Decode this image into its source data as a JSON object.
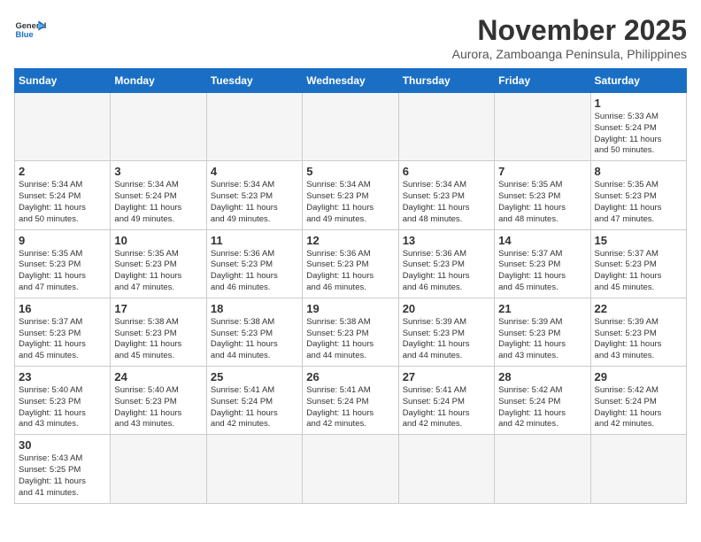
{
  "header": {
    "logo_general": "General",
    "logo_blue": "Blue",
    "month_title": "November 2025",
    "subtitle": "Aurora, Zamboanga Peninsula, Philippines"
  },
  "days_of_week": [
    "Sunday",
    "Monday",
    "Tuesday",
    "Wednesday",
    "Thursday",
    "Friday",
    "Saturday"
  ],
  "weeks": [
    [
      {
        "day": "",
        "info": ""
      },
      {
        "day": "",
        "info": ""
      },
      {
        "day": "",
        "info": ""
      },
      {
        "day": "",
        "info": ""
      },
      {
        "day": "",
        "info": ""
      },
      {
        "day": "",
        "info": ""
      },
      {
        "day": "1",
        "info": "Sunrise: 5:33 AM\nSunset: 5:24 PM\nDaylight: 11 hours\nand 50 minutes."
      }
    ],
    [
      {
        "day": "2",
        "info": "Sunrise: 5:34 AM\nSunset: 5:24 PM\nDaylight: 11 hours\nand 50 minutes."
      },
      {
        "day": "3",
        "info": "Sunrise: 5:34 AM\nSunset: 5:24 PM\nDaylight: 11 hours\nand 49 minutes."
      },
      {
        "day": "4",
        "info": "Sunrise: 5:34 AM\nSunset: 5:23 PM\nDaylight: 11 hours\nand 49 minutes."
      },
      {
        "day": "5",
        "info": "Sunrise: 5:34 AM\nSunset: 5:23 PM\nDaylight: 11 hours\nand 49 minutes."
      },
      {
        "day": "6",
        "info": "Sunrise: 5:34 AM\nSunset: 5:23 PM\nDaylight: 11 hours\nand 48 minutes."
      },
      {
        "day": "7",
        "info": "Sunrise: 5:35 AM\nSunset: 5:23 PM\nDaylight: 11 hours\nand 48 minutes."
      },
      {
        "day": "8",
        "info": "Sunrise: 5:35 AM\nSunset: 5:23 PM\nDaylight: 11 hours\nand 47 minutes."
      }
    ],
    [
      {
        "day": "9",
        "info": "Sunrise: 5:35 AM\nSunset: 5:23 PM\nDaylight: 11 hours\nand 47 minutes."
      },
      {
        "day": "10",
        "info": "Sunrise: 5:35 AM\nSunset: 5:23 PM\nDaylight: 11 hours\nand 47 minutes."
      },
      {
        "day": "11",
        "info": "Sunrise: 5:36 AM\nSunset: 5:23 PM\nDaylight: 11 hours\nand 46 minutes."
      },
      {
        "day": "12",
        "info": "Sunrise: 5:36 AM\nSunset: 5:23 PM\nDaylight: 11 hours\nand 46 minutes."
      },
      {
        "day": "13",
        "info": "Sunrise: 5:36 AM\nSunset: 5:23 PM\nDaylight: 11 hours\nand 46 minutes."
      },
      {
        "day": "14",
        "info": "Sunrise: 5:37 AM\nSunset: 5:23 PM\nDaylight: 11 hours\nand 45 minutes."
      },
      {
        "day": "15",
        "info": "Sunrise: 5:37 AM\nSunset: 5:23 PM\nDaylight: 11 hours\nand 45 minutes."
      }
    ],
    [
      {
        "day": "16",
        "info": "Sunrise: 5:37 AM\nSunset: 5:23 PM\nDaylight: 11 hours\nand 45 minutes."
      },
      {
        "day": "17",
        "info": "Sunrise: 5:38 AM\nSunset: 5:23 PM\nDaylight: 11 hours\nand 45 minutes."
      },
      {
        "day": "18",
        "info": "Sunrise: 5:38 AM\nSunset: 5:23 PM\nDaylight: 11 hours\nand 44 minutes."
      },
      {
        "day": "19",
        "info": "Sunrise: 5:38 AM\nSunset: 5:23 PM\nDaylight: 11 hours\nand 44 minutes."
      },
      {
        "day": "20",
        "info": "Sunrise: 5:39 AM\nSunset: 5:23 PM\nDaylight: 11 hours\nand 44 minutes."
      },
      {
        "day": "21",
        "info": "Sunrise: 5:39 AM\nSunset: 5:23 PM\nDaylight: 11 hours\nand 43 minutes."
      },
      {
        "day": "22",
        "info": "Sunrise: 5:39 AM\nSunset: 5:23 PM\nDaylight: 11 hours\nand 43 minutes."
      }
    ],
    [
      {
        "day": "23",
        "info": "Sunrise: 5:40 AM\nSunset: 5:23 PM\nDaylight: 11 hours\nand 43 minutes."
      },
      {
        "day": "24",
        "info": "Sunrise: 5:40 AM\nSunset: 5:23 PM\nDaylight: 11 hours\nand 43 minutes."
      },
      {
        "day": "25",
        "info": "Sunrise: 5:41 AM\nSunset: 5:24 PM\nDaylight: 11 hours\nand 42 minutes."
      },
      {
        "day": "26",
        "info": "Sunrise: 5:41 AM\nSunset: 5:24 PM\nDaylight: 11 hours\nand 42 minutes."
      },
      {
        "day": "27",
        "info": "Sunrise: 5:41 AM\nSunset: 5:24 PM\nDaylight: 11 hours\nand 42 minutes."
      },
      {
        "day": "28",
        "info": "Sunrise: 5:42 AM\nSunset: 5:24 PM\nDaylight: 11 hours\nand 42 minutes."
      },
      {
        "day": "29",
        "info": "Sunrise: 5:42 AM\nSunset: 5:24 PM\nDaylight: 11 hours\nand 42 minutes."
      }
    ],
    [
      {
        "day": "30",
        "info": "Sunrise: 5:43 AM\nSunset: 5:25 PM\nDaylight: 11 hours\nand 41 minutes."
      },
      {
        "day": "",
        "info": ""
      },
      {
        "day": "",
        "info": ""
      },
      {
        "day": "",
        "info": ""
      },
      {
        "day": "",
        "info": ""
      },
      {
        "day": "",
        "info": ""
      },
      {
        "day": "",
        "info": ""
      }
    ]
  ]
}
